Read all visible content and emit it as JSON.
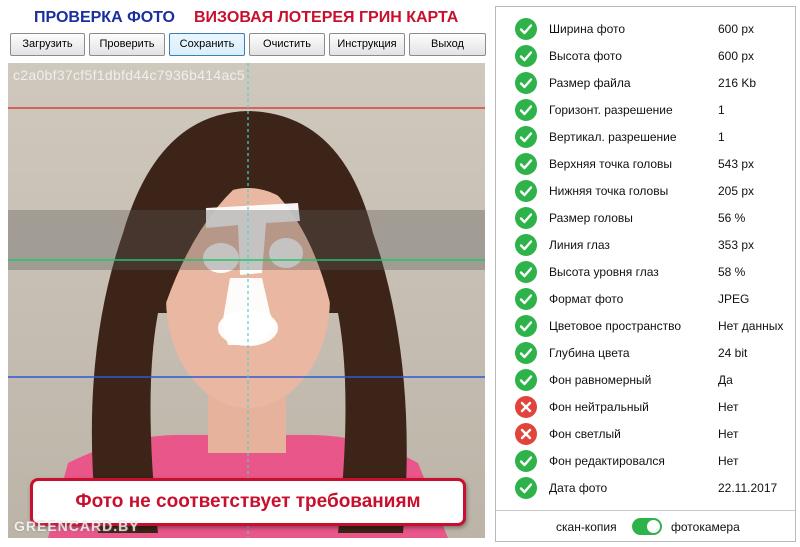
{
  "header": {
    "title_check": "ПРОВЕРКА ФОТО",
    "title_lottery": "ВИЗОВАЯ ЛОТЕРЕЯ ГРИН КАРТА"
  },
  "toolbar": {
    "load": "Загрузить",
    "check": "Проверить",
    "save": "Сохранить",
    "clear": "Очистить",
    "instructions": "Инструкция",
    "exit": "Выход"
  },
  "photo": {
    "hash": "c2a0bf37cf5f1dbfd44c7936b414ac5",
    "watermark": "GREENCARD.BY",
    "verdict": "Фото не соответствует требованиям"
  },
  "checks": [
    {
      "label": "Ширина фото",
      "value": "600 px",
      "status": "ok"
    },
    {
      "label": "Высота фото",
      "value": "600 px",
      "status": "ok"
    },
    {
      "label": "Размер файла",
      "value": "216 Kb",
      "status": "ok"
    },
    {
      "label": "Горизонт. разрешение",
      "value": "1",
      "status": "ok"
    },
    {
      "label": "Вертикал. разрешение",
      "value": "1",
      "status": "ok"
    },
    {
      "label": "Верхняя точка головы",
      "value": "543 px",
      "status": "ok"
    },
    {
      "label": "Нижняя точка головы",
      "value": "205 px",
      "status": "ok"
    },
    {
      "label": "Размер головы",
      "value": "56 %",
      "status": "ok"
    },
    {
      "label": "Линия глаз",
      "value": "353 px",
      "status": "ok"
    },
    {
      "label": "Высота уровня глаз",
      "value": "58 %",
      "status": "ok"
    },
    {
      "label": "Формат фото",
      "value": "JPEG",
      "status": "ok"
    },
    {
      "label": "Цветовое пространство",
      "value": "Нет данных",
      "status": "ok"
    },
    {
      "label": "Глубина цвета",
      "value": "24 bit",
      "status": "ok"
    },
    {
      "label": "Фон равномерный",
      "value": "Да",
      "status": "ok"
    },
    {
      "label": "Фон нейтральный",
      "value": "Нет",
      "status": "bad"
    },
    {
      "label": "Фон светлый",
      "value": "Нет",
      "status": "bad"
    },
    {
      "label": "Фон редактировался",
      "value": "Нет",
      "status": "ok"
    },
    {
      "label": "Дата фото",
      "value": "22.11.2017",
      "status": "ok"
    }
  ],
  "footer": {
    "left_label": "скан-копия",
    "right_label": "фотокамера",
    "toggle_state": "on"
  },
  "colors": {
    "ok": "#2eb24a",
    "bad": "#e0443b",
    "accent_red": "#c8102e",
    "accent_blue": "#1a2f9e"
  }
}
